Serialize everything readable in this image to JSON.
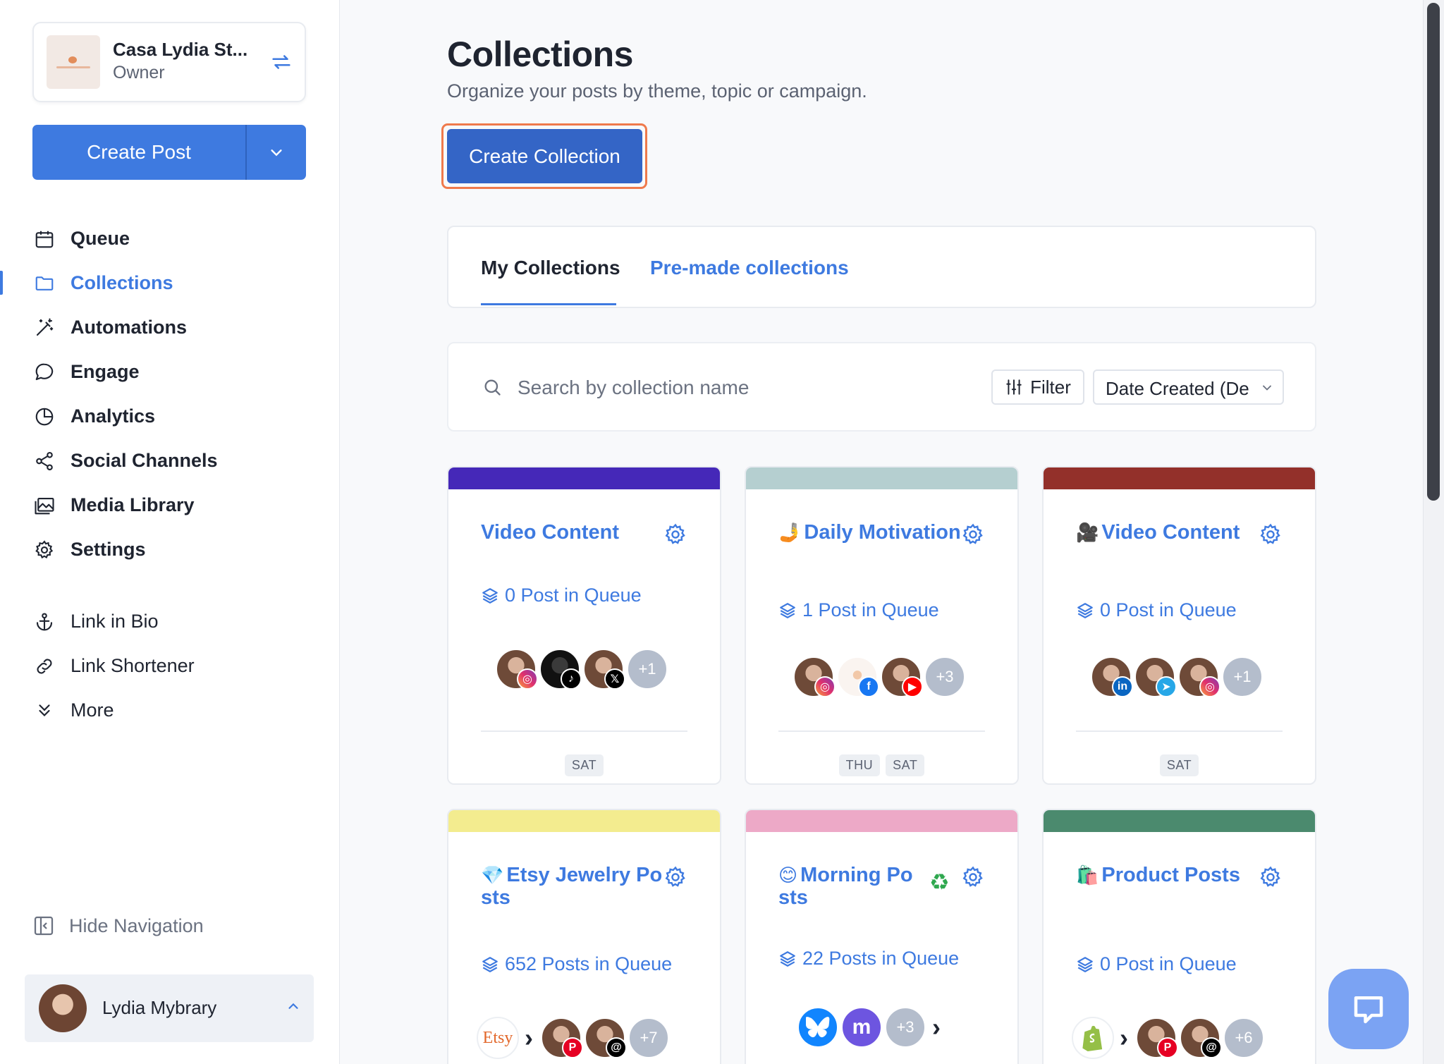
{
  "org": {
    "name": "Casa Lydia St...",
    "role": "Owner"
  },
  "create_post": {
    "label": "Create Post"
  },
  "nav": {
    "primary": [
      {
        "label": "Queue",
        "icon": "calendar-icon"
      },
      {
        "label": "Collections",
        "icon": "folder-icon",
        "active": true
      },
      {
        "label": "Automations",
        "icon": "magic-wand-icon"
      },
      {
        "label": "Engage",
        "icon": "chat-bubble-icon"
      },
      {
        "label": "Analytics",
        "icon": "pie-chart-icon"
      },
      {
        "label": "Social Channels",
        "icon": "share-icon"
      },
      {
        "label": "Media Library",
        "icon": "images-icon"
      },
      {
        "label": "Settings",
        "icon": "gear-icon"
      }
    ],
    "secondary": [
      {
        "label": "Link in Bio",
        "icon": "anchor-icon"
      },
      {
        "label": "Link Shortener",
        "icon": "link-icon"
      },
      {
        "label": "More",
        "icon": "double-chevron-down-icon"
      }
    ],
    "hide_navigation": "Hide Navigation"
  },
  "user": {
    "name": "Lydia Mybrary"
  },
  "page": {
    "title": "Collections",
    "subtitle": "Organize your posts by theme, topic or campaign.",
    "create_collection": "Create Collection"
  },
  "tabs": [
    {
      "label": "My Collections",
      "active": true
    },
    {
      "label": "Pre-made collections",
      "active": false
    }
  ],
  "search": {
    "placeholder": "Search by collection name",
    "filter_label": "Filter",
    "sort_value": "Date Created (Descending)"
  },
  "colors": {
    "accent": "#3e7ae0",
    "create_collection_bg": "#3465c6",
    "focus_ring": "#ef7a4c"
  },
  "collections": [
    {
      "title": "Video Content",
      "emoji": "",
      "color": "#4528b8",
      "queue": "0 Post in Queue",
      "days": [
        "SAT"
      ],
      "more": "+1",
      "networks": [
        "instagram",
        "tiktok",
        "x"
      ]
    },
    {
      "title": "Daily Motivation",
      "emoji": "🤳",
      "color": "#b5cfd0",
      "queue": "1 Post in Queue",
      "days": [
        "THU",
        "SAT"
      ],
      "more": "+3",
      "networks": [
        "instagram",
        "facebook",
        "youtube"
      ]
    },
    {
      "title": "Video Content",
      "emoji": "🎥",
      "color": "#93302a",
      "queue": "0 Post in Queue",
      "days": [
        "SAT"
      ],
      "more": "+1",
      "networks": [
        "linkedin",
        "telegram",
        "instagram"
      ]
    },
    {
      "title": "Etsy Jewelry Posts",
      "emoji": "💎",
      "color": "#f3ec8f",
      "queue": "652 Posts in Queue",
      "days": [],
      "more": "+7",
      "networks": [
        "etsy",
        "pinterest",
        "threads"
      ]
    },
    {
      "title": "Morning Posts",
      "emoji": "😊",
      "color": "#eda9c7",
      "queue": "22 Posts in Queue",
      "days": [],
      "more": "+3",
      "networks": [
        "bluesky",
        "mastodon"
      ],
      "recycle": true
    },
    {
      "title": "Product Posts",
      "emoji": "🛍️",
      "color": "#4b8a6e",
      "queue": "0 Post in Queue",
      "days": [],
      "more": "+6",
      "networks": [
        "shopify",
        "pinterest",
        "threads"
      ]
    }
  ]
}
